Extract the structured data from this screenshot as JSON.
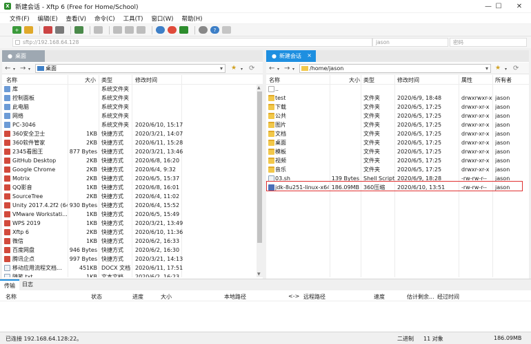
{
  "window": {
    "title": "新建会话 - Xftp 6 (Free for Home/School)",
    "minimize": "—",
    "maximize": "☐",
    "close": "✕"
  },
  "menu": [
    "文件(F)",
    "编辑(E)",
    "查看(V)",
    "命令(C)",
    "工具(T)",
    "窗口(W)",
    "帮助(H)"
  ],
  "address": {
    "host": "sftp://192.168.64.128",
    "username_placeholder": "jason",
    "password_placeholder": "密码"
  },
  "left_pane": {
    "tab_label": "桌面",
    "path": "桌面",
    "columns": [
      "名称",
      "大小",
      "类型",
      "修改时间"
    ],
    "rows": [
      {
        "name": "库",
        "size": "",
        "type": "系统文件夹",
        "modified": "",
        "icon": "sys"
      },
      {
        "name": "控制面板",
        "size": "",
        "type": "系统文件夹",
        "modified": "",
        "icon": "sys"
      },
      {
        "name": "此电脑",
        "size": "",
        "type": "系统文件夹",
        "modified": "",
        "icon": "sys"
      },
      {
        "name": "网络",
        "size": "",
        "type": "系统文件夹",
        "modified": "",
        "icon": "sys"
      },
      {
        "name": "PC-3046",
        "size": "",
        "type": "系统文件夹",
        "modified": "2020/6/10, 15:17",
        "icon": "sys"
      },
      {
        "name": "360安全卫士",
        "size": "1KB",
        "type": "快捷方式",
        "modified": "2020/3/21, 14:07",
        "icon": "shortcut"
      },
      {
        "name": "360软件管家",
        "size": "2KB",
        "type": "快捷方式",
        "modified": "2020/6/11, 15:28",
        "icon": "shortcut"
      },
      {
        "name": "2345看图王",
        "size": "877 Bytes",
        "type": "快捷方式",
        "modified": "2020/3/21, 13:46",
        "icon": "shortcut"
      },
      {
        "name": "GitHub Desktop",
        "size": "2KB",
        "type": "快捷方式",
        "modified": "2020/6/8, 16:20",
        "icon": "shortcut"
      },
      {
        "name": "Google Chrome",
        "size": "2KB",
        "type": "快捷方式",
        "modified": "2020/6/4, 9:32",
        "icon": "shortcut"
      },
      {
        "name": "Motrix",
        "size": "2KB",
        "type": "快捷方式",
        "modified": "2020/6/5, 15:37",
        "icon": "shortcut"
      },
      {
        "name": "QQ影音",
        "size": "1KB",
        "type": "快捷方式",
        "modified": "2020/6/8, 16:01",
        "icon": "shortcut"
      },
      {
        "name": "SourceTree",
        "size": "2KB",
        "type": "快捷方式",
        "modified": "2020/6/4, 11:02",
        "icon": "shortcut"
      },
      {
        "name": "Unity 2017.4.2f2 (64...",
        "size": "930 Bytes",
        "type": "快捷方式",
        "modified": "2020/6/4, 15:52",
        "icon": "shortcut"
      },
      {
        "name": "VMware Workstati...",
        "size": "1KB",
        "type": "快捷方式",
        "modified": "2020/6/5, 15:49",
        "icon": "shortcut"
      },
      {
        "name": "WPS 2019",
        "size": "1KB",
        "type": "快捷方式",
        "modified": "2020/3/21, 13:49",
        "icon": "shortcut"
      },
      {
        "name": "Xftp 6",
        "size": "2KB",
        "type": "快捷方式",
        "modified": "2020/6/10, 11:36",
        "icon": "shortcut"
      },
      {
        "name": "微信",
        "size": "1KB",
        "type": "快捷方式",
        "modified": "2020/6/2, 16:33",
        "icon": "shortcut"
      },
      {
        "name": "百度网盘",
        "size": "946 Bytes",
        "type": "快捷方式",
        "modified": "2020/6/2, 16:30",
        "icon": "shortcut"
      },
      {
        "name": "腾讯企点",
        "size": "997 Bytes",
        "type": "快捷方式",
        "modified": "2020/3/21, 14:13",
        "icon": "shortcut"
      },
      {
        "name": "移动应用流程文档...",
        "size": "451KB",
        "type": "DOCX 文档",
        "modified": "2020/6/11, 17:51",
        "icon": "file"
      },
      {
        "name": "随笔.txt",
        "size": "1KB",
        "type": "文本文档",
        "modified": "2020/6/2, 16:23",
        "icon": "file"
      }
    ]
  },
  "right_pane": {
    "tab_label": "新建会话",
    "tab_close": "×",
    "path": "/home/jason",
    "columns": [
      "名称",
      "大小",
      "类型",
      "修改时间",
      "属性",
      "所有者"
    ],
    "rows": [
      {
        "name": "..",
        "size": "",
        "type": "",
        "modified": "",
        "attrs": "",
        "owner": "",
        "icon": "back"
      },
      {
        "name": "test",
        "size": "",
        "type": "文件夹",
        "modified": "2020/6/9, 18:48",
        "attrs": "drwxrwxr-x",
        "owner": "jason",
        "icon": "folder"
      },
      {
        "name": "下载",
        "size": "",
        "type": "文件夹",
        "modified": "2020/6/5, 17:25",
        "attrs": "drwxr-xr-x",
        "owner": "jason",
        "icon": "folder"
      },
      {
        "name": "公共",
        "size": "",
        "type": "文件夹",
        "modified": "2020/6/5, 17:25",
        "attrs": "drwxr-xr-x",
        "owner": "jason",
        "icon": "folder"
      },
      {
        "name": "图片",
        "size": "",
        "type": "文件夹",
        "modified": "2020/6/5, 17:25",
        "attrs": "drwxr-xr-x",
        "owner": "jason",
        "icon": "folder"
      },
      {
        "name": "文档",
        "size": "",
        "type": "文件夹",
        "modified": "2020/6/5, 17:25",
        "attrs": "drwxr-xr-x",
        "owner": "jason",
        "icon": "folder"
      },
      {
        "name": "桌面",
        "size": "",
        "type": "文件夹",
        "modified": "2020/6/5, 17:25",
        "attrs": "drwxr-xr-x",
        "owner": "jason",
        "icon": "folder"
      },
      {
        "name": "模板",
        "size": "",
        "type": "文件夹",
        "modified": "2020/6/5, 17:25",
        "attrs": "drwxr-xr-x",
        "owner": "jason",
        "icon": "folder"
      },
      {
        "name": "视频",
        "size": "",
        "type": "文件夹",
        "modified": "2020/6/5, 17:25",
        "attrs": "drwxr-xr-x",
        "owner": "jason",
        "icon": "folder"
      },
      {
        "name": "音乐",
        "size": "",
        "type": "文件夹",
        "modified": "2020/6/5, 17:25",
        "attrs": "drwxr-xr-x",
        "owner": "jason",
        "icon": "folder"
      },
      {
        "name": "03.sh",
        "size": "139 Bytes",
        "type": "Shell Script",
        "modified": "2020/6/9, 18:28",
        "attrs": "-rw-rw-r--",
        "owner": "jason",
        "icon": "file"
      },
      {
        "name": "jdk-8u251-linux-x64...",
        "size": "186.09MB",
        "type": "360压缩",
        "modified": "2020/6/10, 13:51",
        "attrs": "-rw-rw-r--",
        "owner": "jason",
        "icon": "zip"
      }
    ]
  },
  "bottom": {
    "tabs": [
      "传输",
      "日志"
    ],
    "columns": [
      "名称",
      "状态",
      "进度",
      "大小",
      "本地路径",
      "<->",
      "远程路径",
      "速度",
      "估计剩余...",
      "经过时间"
    ]
  },
  "status": {
    "connected": "已连接 192.168.64.128:22。",
    "mode": "二进制",
    "objects": "11 对象",
    "size": "186.09MB"
  },
  "colors": {
    "active_tab": "#1e8fe0",
    "highlight_border": "#e03030",
    "folder": "#f2c84b"
  }
}
